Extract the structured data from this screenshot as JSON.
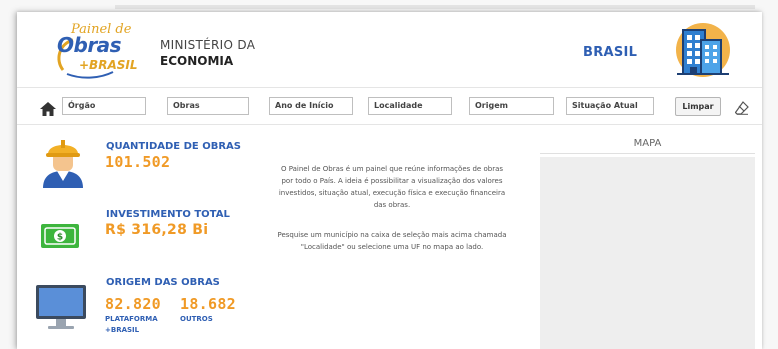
{
  "header": {
    "logo": {
      "line1": "Painel de",
      "line2": "Obras",
      "line3": "+BRASIL"
    },
    "ministry_line1": "MINISTÉRIO DA",
    "ministry_line2": "ECONOMIA",
    "region": "BRASIL",
    "region_icon": "building-icon"
  },
  "filters": {
    "home_icon": "home-icon",
    "items": [
      {
        "label": "Órgão"
      },
      {
        "label": "Obras"
      },
      {
        "label": "Ano de Início"
      },
      {
        "label": "Localidade"
      },
      {
        "label": "Origem"
      },
      {
        "label": "Situação Atual"
      }
    ],
    "clear_label": "Limpar",
    "eraser_icon": "eraser-icon"
  },
  "kpis": {
    "quantidade": {
      "title": "QUANTIDADE DE OBRAS",
      "value": "101.502",
      "icon": "worker-icon"
    },
    "investimento": {
      "title": "INVESTIMENTO TOTAL",
      "value": "R$ 316,28 Bi",
      "icon": "money-icon"
    },
    "origem": {
      "title": "ORIGEM DAS OBRAS",
      "icon": "monitor-icon",
      "plataforma_value": "82.820",
      "plataforma_label_1": "PLATAFORMA",
      "plataforma_label_2": "+BRASIL",
      "outros_value": "18.682",
      "outros_label": "OUTROS"
    }
  },
  "description": {
    "p1_l1": "O Painel de Obras é um painel que reúne informações de obras",
    "p1_l2": "por todo o País. A ideia é possibilitar a visualização dos valores",
    "p1_l3": "investidos, situação atual, execução física e execução financeira",
    "p1_l4": "das obras.",
    "p2_l1": "Pesquise um município na caixa de seleção mais acima chamada",
    "p2_l2": "\"Localidade\" ou selecione uma UF no mapa ao lado."
  },
  "map": {
    "title": "MAPA"
  },
  "colors": {
    "brand_blue": "#2f5fb3",
    "accent_orange": "#f09a26",
    "logo_gold": "#e2a423"
  }
}
